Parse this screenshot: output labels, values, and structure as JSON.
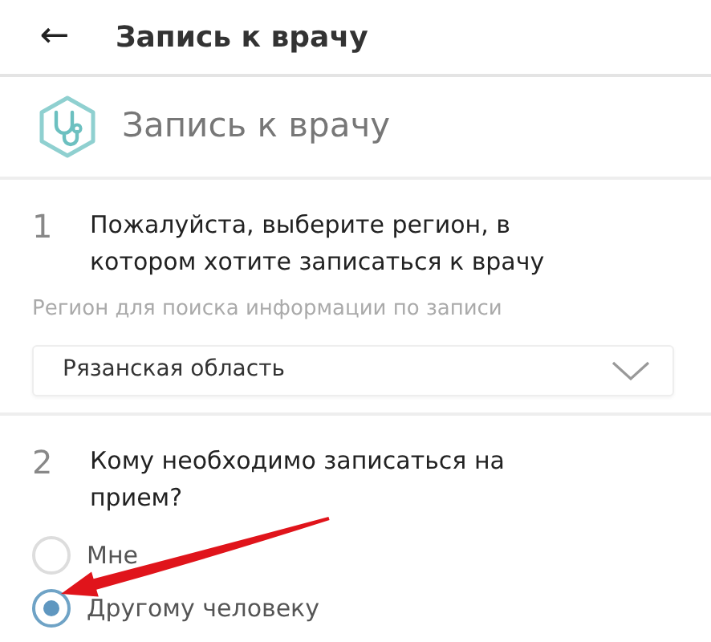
{
  "app_bar": {
    "back": "←",
    "title": "Запись к врачу"
  },
  "service": {
    "title": "Запись к врачу"
  },
  "steps": [
    {
      "number": "1",
      "question": "Пожалуйста, выберите регион, в котором хотите записаться к врачу",
      "kind": "select",
      "hint": "Регион для поиска информации по записи",
      "value": "Рязанская область"
    },
    {
      "number": "2",
      "question": "Кому необходимо записаться на прием?",
      "kind": "radio",
      "options": [
        {
          "label": "Мне",
          "selected": false
        },
        {
          "label": "Другому человеку",
          "selected": true
        }
      ]
    }
  ]
}
